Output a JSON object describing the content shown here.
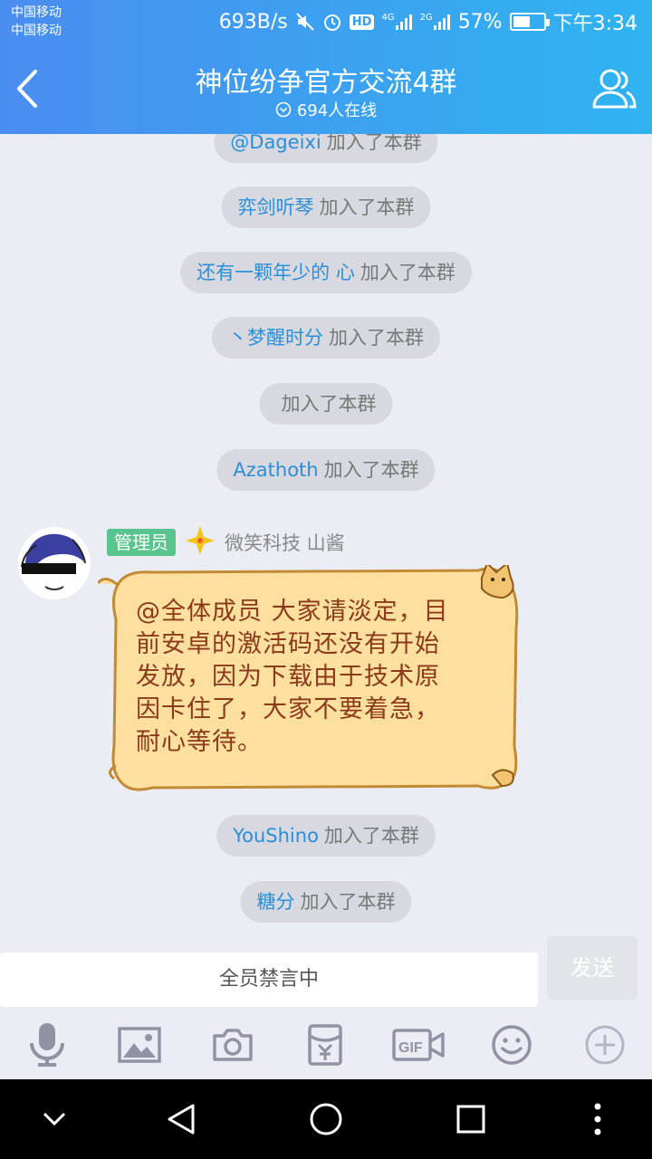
{
  "status": {
    "carrier1": "中国移动",
    "carrier2": "中国移动",
    "speed": "693B/s",
    "hd": "HD",
    "net1": "4G",
    "net2": "2G",
    "battery": "57%",
    "battery_level": 0.57,
    "time": "下午3:34"
  },
  "header": {
    "title": "神位纷争官方交流4群",
    "online": "694人在线"
  },
  "system_messages": [
    {
      "user": "@Dageixi",
      "text": "加入了本群"
    },
    {
      "user": "弈剑听琴",
      "text": "加入了本群"
    },
    {
      "user": "还有一颗年少的 心",
      "text": "加入了本群"
    },
    {
      "user": "丶梦醒时分",
      "text": "加入了本群"
    },
    {
      "user": "",
      "text": "加入了本群"
    },
    {
      "user": "Azathoth",
      "text": "加入了本群"
    }
  ],
  "message": {
    "badge": "管理员",
    "sender": "微笑科技 山酱",
    "lines": [
      "@全体成员 大家请淡定，目",
      "前安卓的激活码还没有开始",
      "发放，因为下载由于技术原",
      "因卡住了，大家不要着急，",
      "耐心等待。"
    ]
  },
  "system_messages_after": [
    {
      "user": "YouShino",
      "text": "加入了本群"
    },
    {
      "user": "糖分",
      "text": "加入了本群"
    }
  ],
  "input": {
    "muted_text": "全员禁言中",
    "send_label": "发送"
  },
  "colors": {
    "header_start": "#4a8df0",
    "header_end": "#2fb4f0",
    "username": "#2a8fd6",
    "bubble_fill": "#fde0a0",
    "bubble_text": "#8b3a1a",
    "admin_badge": "#59c48d"
  },
  "icons": {
    "toolbar": [
      "microphone-icon",
      "image-icon",
      "camera-icon",
      "red-packet-icon",
      "gif-icon",
      "emoji-icon",
      "plus-icon"
    ],
    "nav": [
      "chevron-down-icon",
      "back-triangle-icon",
      "home-circle-icon",
      "recents-square-icon",
      "more-dots-icon"
    ]
  }
}
